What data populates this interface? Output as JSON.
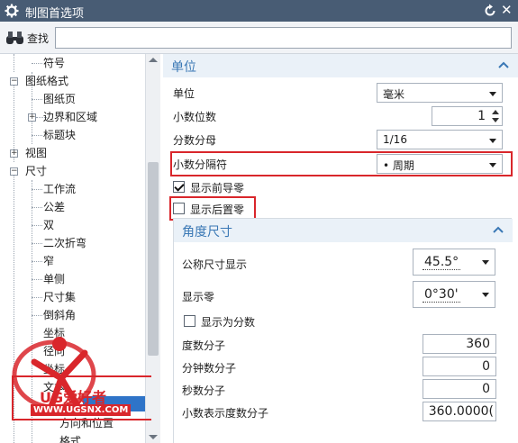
{
  "window": {
    "title": "制图首选项"
  },
  "search": {
    "label": "查找",
    "value": ""
  },
  "tree": {
    "items": [
      {
        "label": "符号"
      },
      {
        "label": "图纸格式"
      },
      {
        "label": "图纸页"
      },
      {
        "label": "边界和区域"
      },
      {
        "label": "标题块"
      },
      {
        "label": "视图"
      },
      {
        "label": "尺寸"
      },
      {
        "label": "工作流"
      },
      {
        "label": "公差"
      },
      {
        "label": "双"
      },
      {
        "label": "二次折弯"
      },
      {
        "label": "窄"
      },
      {
        "label": "单侧"
      },
      {
        "label": "尺寸集"
      },
      {
        "label": "倒斜角"
      },
      {
        "label": "坐标"
      },
      {
        "label": "径向"
      },
      {
        "label": "坐标"
      },
      {
        "label": "文本"
      },
      {
        "label": "单位"
      },
      {
        "label": "方向和位置"
      },
      {
        "label": "格式"
      }
    ]
  },
  "units_section": {
    "title": "单位",
    "unit": {
      "label": "单位",
      "value": "毫米"
    },
    "decimal_places": {
      "label": "小数位数",
      "value": "1"
    },
    "fraction_denominator": {
      "label": "分数分母",
      "value": "1/16"
    },
    "decimal_separator": {
      "label": "小数分隔符",
      "value": "• 周期"
    },
    "show_leading_zeros": {
      "label": "显示前导零",
      "checked": true
    },
    "show_trailing_zeros": {
      "label": "显示后置零",
      "checked": false
    }
  },
  "angle_section": {
    "title": "角度尺寸",
    "nominal_display": {
      "label": "公称尺寸显示",
      "value": "45.5°"
    },
    "show_zero": {
      "label": "显示零",
      "value": "0°30'"
    },
    "show_as_fraction": {
      "label": "显示为分数",
      "checked": false
    },
    "degree_numerator": {
      "label": "度数分子",
      "value": "360"
    },
    "minute_numerator": {
      "label": "分钟数分子",
      "value": "0"
    },
    "second_numerator": {
      "label": "秒数分子",
      "value": "0"
    },
    "decimal_degree_numerator": {
      "label": "小数表示度数分子",
      "value": "360.0000("
    }
  },
  "watermark": {
    "brand": "UG爱好者",
    "url": "WWW.UGSNX.COM"
  },
  "colors": {
    "titlebar": "#485c74",
    "accent": "#3a78b5",
    "highlight": "#d9262b",
    "selection": "#2f74c8"
  }
}
